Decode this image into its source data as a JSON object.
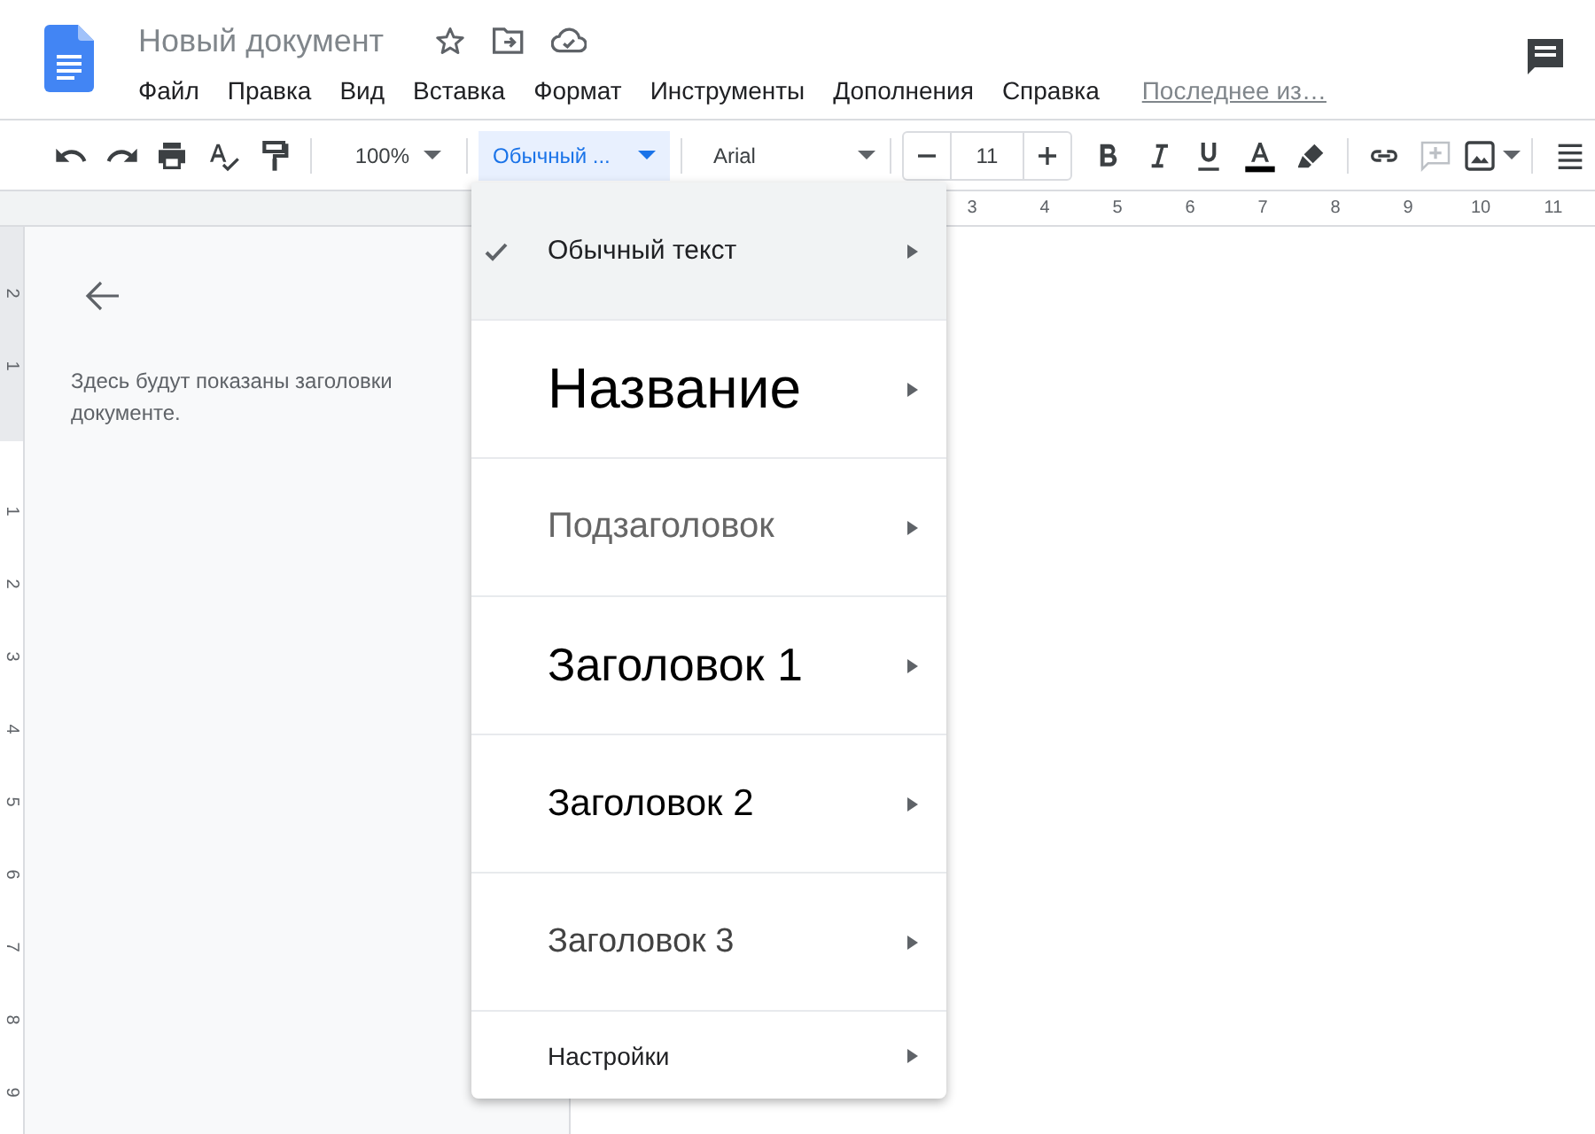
{
  "header": {
    "title": "Новый документ",
    "menu": [
      {
        "label": "Файл"
      },
      {
        "label": "Правка"
      },
      {
        "label": "Вид"
      },
      {
        "label": "Вставка"
      },
      {
        "label": "Формат"
      },
      {
        "label": "Инструменты"
      },
      {
        "label": "Дополнения"
      },
      {
        "label": "Справка"
      }
    ],
    "last_edit": "Последнее из…"
  },
  "toolbar": {
    "zoom": "100%",
    "style": {
      "label": "Обычный ...",
      "open": true
    },
    "font": "Arial",
    "font_size": "11"
  },
  "rulers": {
    "horizontal": [
      "3",
      "4",
      "5",
      "6",
      "7",
      "8",
      "9",
      "10",
      "11"
    ],
    "vertical": [
      "2",
      "1",
      "1",
      "2",
      "3",
      "4",
      "5",
      "6",
      "7",
      "8",
      "9"
    ]
  },
  "outline": {
    "lines": [
      "Здесь будут показаны заголовки",
      "документе."
    ]
  },
  "style_menu": [
    {
      "kind": "normal",
      "label": "Обычный текст",
      "selected": true
    },
    {
      "kind": "title",
      "label": "Название",
      "selected": false
    },
    {
      "kind": "subtitle",
      "label": "Подзаголовок",
      "selected": false
    },
    {
      "kind": "heading1",
      "label": "Заголовок 1",
      "selected": false
    },
    {
      "kind": "heading2",
      "label": "Заголовок 2",
      "selected": false
    },
    {
      "kind": "heading3",
      "label": "Заголовок 3",
      "selected": false
    },
    {
      "kind": "options",
      "label": "Настройки",
      "selected": false
    }
  ]
}
